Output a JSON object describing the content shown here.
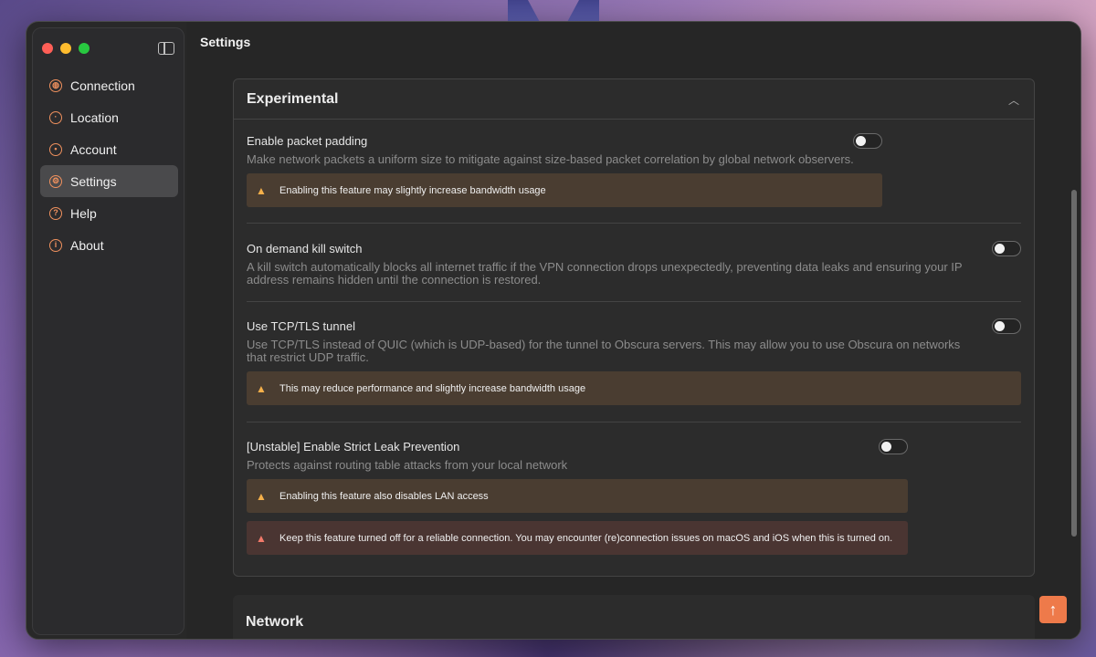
{
  "window": {
    "title": "Settings"
  },
  "sidebar": {
    "items": [
      {
        "label": "Connection",
        "icon": "globe-icon",
        "active": false
      },
      {
        "label": "Location",
        "icon": "pin-icon",
        "active": false
      },
      {
        "label": "Account",
        "icon": "user-icon",
        "active": false
      },
      {
        "label": "Settings",
        "icon": "gear-icon",
        "active": true
      },
      {
        "label": "Help",
        "icon": "question-icon",
        "active": false
      },
      {
        "label": "About",
        "icon": "info-icon",
        "active": false
      }
    ]
  },
  "experimental": {
    "title": "Experimental",
    "settings": [
      {
        "title": "Enable packet padding",
        "description": "Make network packets a uniform size to mitigate against size-based packet correlation by global network observers.",
        "enabled": false,
        "warnings": [
          "Enabling this feature may slightly increase bandwidth usage"
        ]
      },
      {
        "title": "On demand kill switch",
        "description": "A kill switch automatically blocks all internet traffic if the VPN connection drops unexpectedly, preventing data leaks and ensuring your IP address remains hidden until the connection is restored.",
        "enabled": false,
        "warnings": []
      },
      {
        "title": "Use TCP/TLS tunnel",
        "description": "Use TCP/TLS instead of QUIC (which is UDP-based) for the tunnel to Obscura servers. This may allow you to use Obscura on networks that restrict UDP traffic.",
        "enabled": false,
        "warnings": [
          "This may reduce performance and slightly increase bandwidth usage"
        ]
      },
      {
        "title": "[Unstable] Enable Strict Leak Prevention",
        "description": "Protects against routing table attacks from your local network",
        "enabled": false,
        "warnings": [
          "Enabling this feature also disables LAN access",
          "Keep this feature turned off for a reliable connection. You may encounter (re)connection issues on macOS and iOS when this is turned on."
        ]
      }
    ]
  },
  "network": {
    "title": "Network"
  },
  "colors": {
    "accent": "#ee7a4a",
    "warning_bg": "#4a3d31",
    "danger_bg": "#4a3532"
  }
}
